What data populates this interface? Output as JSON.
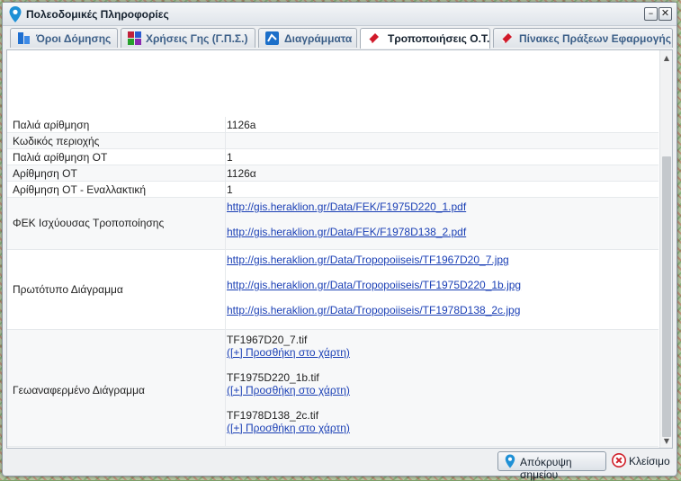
{
  "window": {
    "title": "Πολεοδομικές Πληροφορίες",
    "minimize_symbol": "–",
    "close_symbol": "✕"
  },
  "tabs": [
    {
      "label": "Όροι Δόμησης",
      "icon": "blue-building-icon",
      "active": false
    },
    {
      "label": "Χρήσεις Γης (Γ.Π.Σ.)",
      "icon": "colored-grid-icon",
      "active": false
    },
    {
      "label": "Διαγράμματα",
      "icon": "blue-diagram-icon",
      "active": false
    },
    {
      "label": "Τροποποιήσεις Ο.Τ.",
      "icon": "red-eraser-icon",
      "active": true
    },
    {
      "label": "Πίνακες Πράξεων Εφαρμογής",
      "icon": "red-eraser-icon",
      "active": false
    }
  ],
  "properties": {
    "old_numbering": {
      "key": "Παλιά αρίθμηση",
      "value": "1126a"
    },
    "area_code": {
      "key": "Κωδικός περιοχής",
      "value": ""
    },
    "old_ot_numbering": {
      "key": "Παλιά αρίθμηση ΟΤ",
      "value": "1"
    },
    "ot_numbering": {
      "key": "Αρίθμηση ΟΤ",
      "value": "1126α"
    },
    "ot_numbering_alt": {
      "key": "Αρίθμηση ΟΤ - Εναλλακτική",
      "value": "1"
    },
    "fek": {
      "key": "ΦΕΚ Ισχύουσας Τροποποίησης",
      "links": [
        "http://gis.heraklion.gr/Data/FEK/F1975D220_1.pdf",
        "http://gis.heraklion.gr/Data/FEK/F1978D138_2.pdf"
      ]
    },
    "original_diagram": {
      "key": "Πρωτότυπο Διάγραμμα",
      "links": [
        "http://gis.heraklion.gr/Data/Tropopoiiseis/TF1967D20_7.jpg",
        "http://gis.heraklion.gr/Data/Tropopoiiseis/TF1975D220_1b.jpg",
        "http://gis.heraklion.gr/Data/Tropopoiiseis/TF1978D138_2c.jpg"
      ]
    },
    "georef_diagram": {
      "key": "Γεωαναφερμένο Διάγραμμα",
      "add_label": "([+] Προσθήκη στο χάρτη)",
      "files": [
        "TF1967D20_7.tif",
        "TF1975D220_1b.tif",
        "TF1978D138_2c.tif"
      ]
    }
  },
  "footer": {
    "hide_point_label": "Απόκρυψη σημείου",
    "close_label": "Κλείσιμο"
  },
  "colors": {
    "link": "#1a3fb5",
    "accent": "#3c5f88",
    "close_icon": "#d0202a",
    "pin_icon": "#1e90d6"
  }
}
